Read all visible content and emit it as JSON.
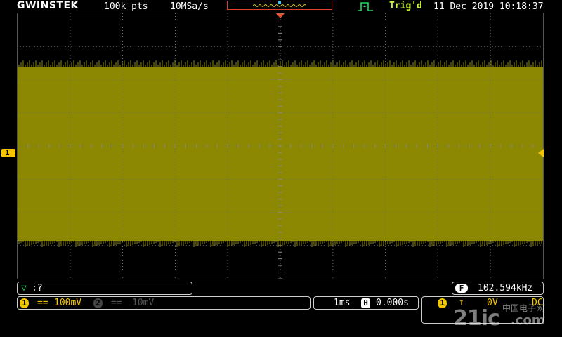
{
  "header": {
    "brand": "GWINSTEK",
    "record_length": "100k pts",
    "sample_rate": "10MSa/s",
    "trigger_status": "Trig'd",
    "datetime": "11 Dec 2019 10:18:37",
    "trigger_status_color": "#c8ee40",
    "trigger_icon": "trigger-edge-icon"
  },
  "display": {
    "channel_marker": "1",
    "trace_color": "#8a8700",
    "grid_color": "#6a6a6a",
    "trigger_position_marker_color": "#f0502a"
  },
  "math": {
    "icon": "math-triangle-icon",
    "label": ":?"
  },
  "frequency": {
    "badge": "F",
    "value": "102.594kHz"
  },
  "channels": {
    "ch1": {
      "badge": "1",
      "coupling": "==",
      "scale": "100mV",
      "color": "#f6c400"
    },
    "ch2": {
      "badge": "2",
      "coupling": "==",
      "scale": "10mV",
      "color": "#555555"
    }
  },
  "timebase": {
    "scale": "1ms",
    "position_badge": "H",
    "position": "0.000s"
  },
  "trigger": {
    "source_badge": "1",
    "slope_icon": "rising-edge-icon",
    "slope_symbol": "↑",
    "level": "0V",
    "coupling": "DC"
  },
  "watermark": {
    "main": "21ic",
    "sub": "中国电子网",
    "domain": ".com"
  }
}
